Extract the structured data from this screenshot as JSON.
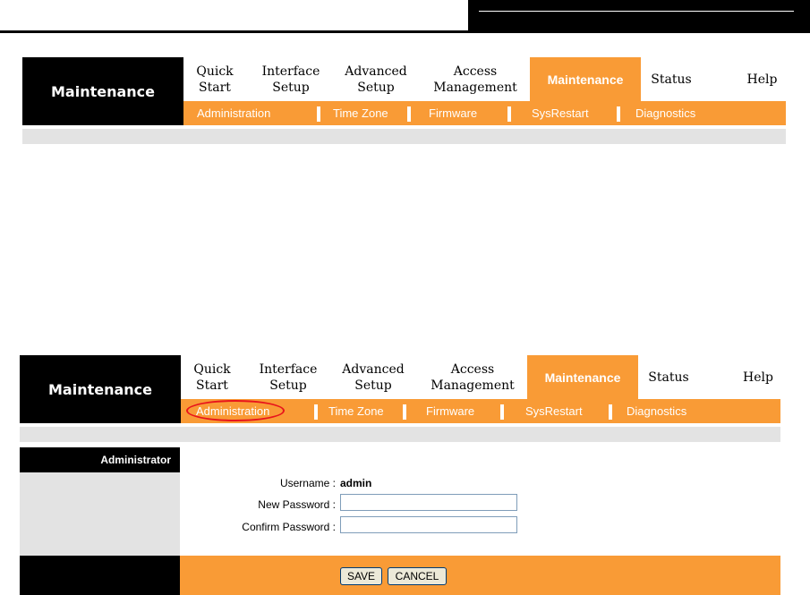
{
  "colors": {
    "orange": "#F99B36",
    "black": "#000000",
    "gray": "#E3E3E3",
    "highlight": "#E8141C"
  },
  "panel": {
    "logo": "Maintenance",
    "nav": [
      {
        "label": "Quick\nStart"
      },
      {
        "label": "Interface\nSetup"
      },
      {
        "label": "Advanced\nSetup"
      },
      {
        "label": "Access\nManagement"
      },
      {
        "label": "Maintenance",
        "active": true
      },
      {
        "label": "Status"
      },
      {
        "label": "Help"
      }
    ],
    "subnav": [
      "Administration",
      "Time Zone",
      "Firmware",
      "SysRestart",
      "Diagnostics"
    ]
  },
  "admin": {
    "section_title": "Administrator",
    "username_label": "Username :",
    "username_value": "admin",
    "new_password_label": "New Password :",
    "new_password_value": "",
    "confirm_password_label": "Confirm Password :",
    "confirm_password_value": "",
    "save_label": "SAVE",
    "cancel_label": "CANCEL"
  }
}
